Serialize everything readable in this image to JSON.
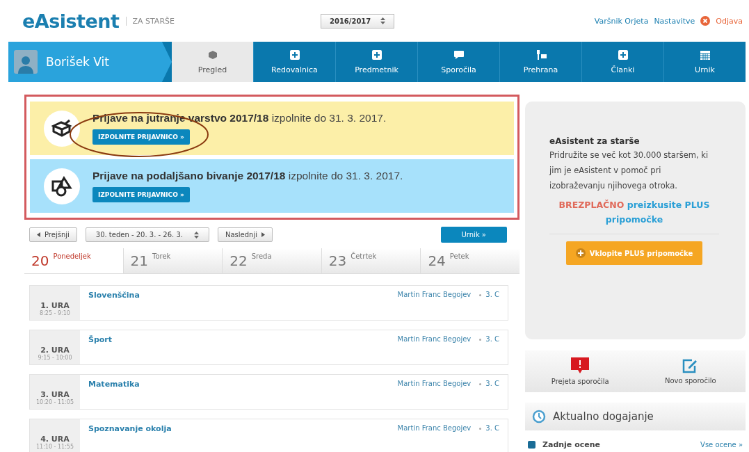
{
  "header": {
    "logo": "eAsistent",
    "subtitle": "ZA STARŠE",
    "year_select": "2016/2017",
    "user_link": "Varšnik Orjeta",
    "settings_link": "Nastavitve",
    "logout_link": "Odjava"
  },
  "nav": {
    "student": "Borišek Vit",
    "items": [
      {
        "label": "Pregled",
        "kind": "cube",
        "selected": true
      },
      {
        "label": "Redovalnica",
        "kind": "plus",
        "selected": false
      },
      {
        "label": "Predmetnik",
        "kind": "plus",
        "selected": false
      },
      {
        "label": "Sporočila",
        "kind": "chat",
        "selected": false
      },
      {
        "label": "Prehrana",
        "kind": "food",
        "selected": false
      },
      {
        "label": "Članki",
        "kind": "plus",
        "selected": false
      },
      {
        "label": "Urnik",
        "kind": "calendar",
        "selected": false
      }
    ]
  },
  "alerts": [
    {
      "kind": "morning",
      "text": "**Prijave na jutranje varstvo 2017/18** izpolnite do 31. 3. 2017.",
      "button": "IZPOLNITE PRIJAVNICO »",
      "circled": true
    },
    {
      "kind": "afternoon",
      "text": "**Prijave na podaljšano bivanje 2017/18** izpolnite do 31. 3. 2017.",
      "button": "IZPOLNITE PRIJAVNICO »",
      "circled": false
    }
  ],
  "week_nav": {
    "prev": "Prejšnji",
    "week": "30. teden - 20. 3. - 26. 3.",
    "next": "Naslednji",
    "schedule_button": "Urnik »"
  },
  "days": [
    {
      "number": "20",
      "name": "Ponedeljek",
      "selected": true
    },
    {
      "number": "21",
      "name": "Torek",
      "selected": false
    },
    {
      "number": "22",
      "name": "Sreda",
      "selected": false
    },
    {
      "number": "23",
      "name": "Četrtek",
      "selected": false
    },
    {
      "number": "24",
      "name": "Petek",
      "selected": false
    }
  ],
  "lessons": [
    {
      "period": "1. URA",
      "time": "8:25 - 9:10",
      "subject": "Slovenščina",
      "teacher": "Martin Franc Begojev",
      "class": "3. C"
    },
    {
      "period": "2. URA",
      "time": "9:15 - 10:00",
      "subject": "Šport",
      "teacher": "Martin Franc Begojev",
      "class": "3. C"
    },
    {
      "period": "3. URA",
      "time": "10:20 - 11:05",
      "subject": "Matematika",
      "teacher": "Martin Franc Begojev",
      "class": "3. C"
    },
    {
      "period": "4. URA",
      "time": "11:10 - 11:55",
      "subject": "Spoznavanje okolja",
      "teacher": "Martin Franc Begojev",
      "class": "3. C"
    }
  ],
  "promo": {
    "title": "eAsistent za starše",
    "body": "Pridružite se več kot 30.000 staršem, ki jim je eAsistent v pomoč pri izobraževanju njihovega otroka.",
    "offer_highlight": "BREZPLAČNO",
    "offer_rest": "preizkusite PLUS pripomočke",
    "button": "Vklopite PLUS pripomočke"
  },
  "messages": [
    {
      "label": "Prejeta sporočila",
      "kind": "alert"
    },
    {
      "label": "Novo sporočilo",
      "kind": "compose"
    }
  ],
  "events": {
    "title": "Aktualno dogajanje",
    "latest_grades": "Zadnje ocene",
    "all_grades": "Vse ocene »"
  }
}
